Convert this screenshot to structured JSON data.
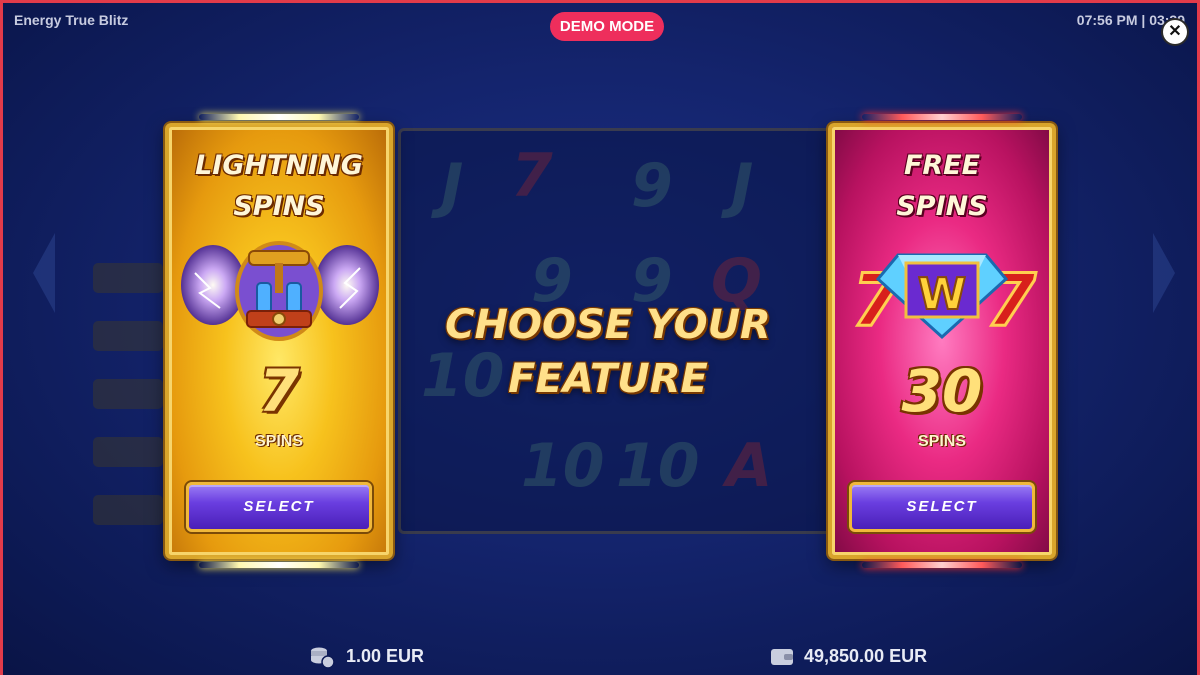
{
  "header": {
    "game_title": "Energy True Blitz",
    "demo_badge": "DEMO MODE",
    "clock": "07:56 PM | 03:39",
    "close_icon": "close-icon"
  },
  "main": {
    "prompt_line1": "CHOOSE YOUR",
    "prompt_line2": "FEATURE"
  },
  "features": [
    {
      "title_line1": "LIGHTNING",
      "title_line2": "SPINS",
      "count": "7",
      "count_label": "SPINS",
      "button_label": "SELECT",
      "icon": "tesla-coil-icon",
      "accent": "#f7c21d"
    },
    {
      "title_line1": "FREE",
      "title_line2": "SPINS",
      "count": "30",
      "count_label": "SPINS",
      "button_label": "SELECT",
      "icon": "diamond-w-icon",
      "accent": "#ea2a83"
    }
  ],
  "footer": {
    "bet": "1.00 EUR",
    "bet_icon": "coins-icon",
    "balance": "49,850.00 EUR",
    "balance_icon": "wallet-icon"
  },
  "colors": {
    "background": "#14246d",
    "demo_badge": "#ee2e5c",
    "frame_border": "#e23b4a",
    "button": "#6a3ee0"
  }
}
